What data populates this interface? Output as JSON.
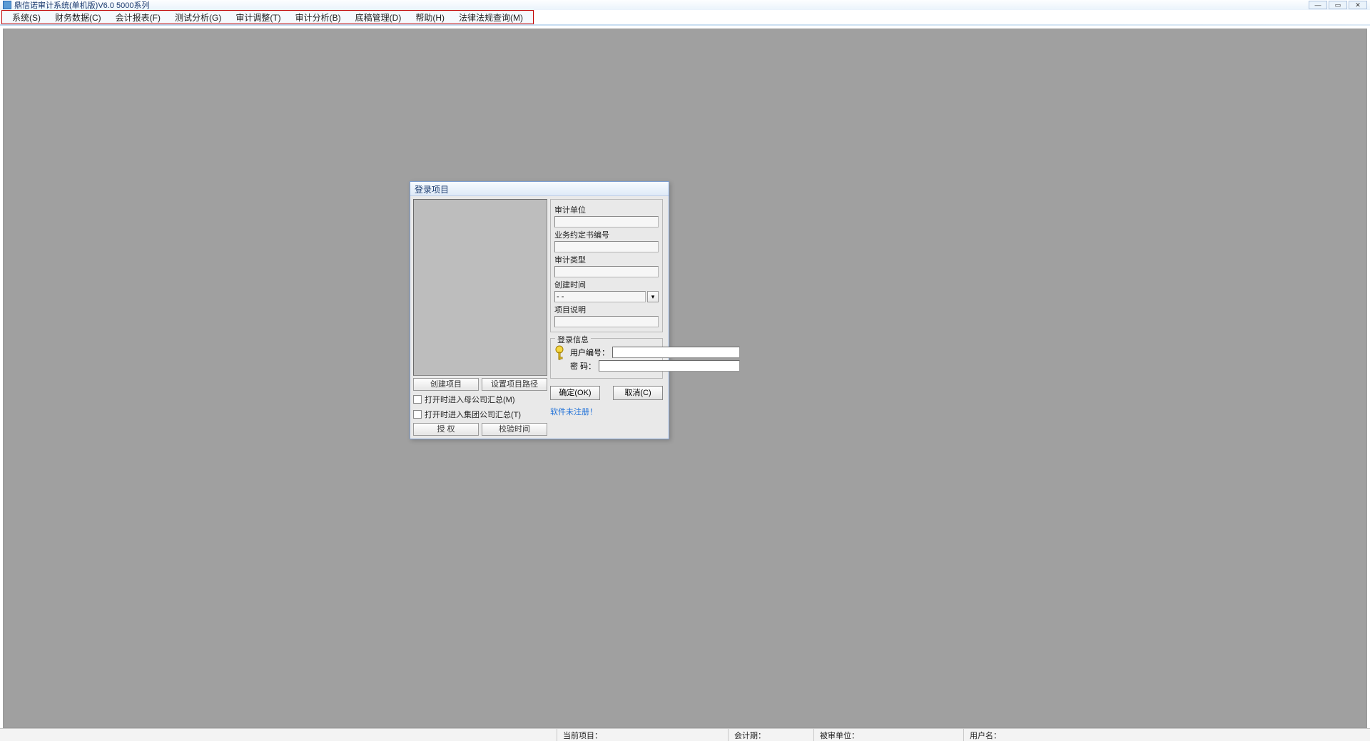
{
  "titlebar": {
    "title": "鼎信诺审计系统(单机版)V6.0 5000系列"
  },
  "menu": {
    "items": [
      "系统(S)",
      "财务数据(C)",
      "会计报表(F)",
      "测试分析(G)",
      "审计调整(T)",
      "审计分析(B)",
      "底稿管理(D)",
      "帮助(H)",
      "法律法规查询(M)"
    ]
  },
  "dialog": {
    "title": "登录项目",
    "left": {
      "create_project": "创建项目",
      "set_path": "设置项目路径",
      "cb_parent": "打开时进入母公司汇总(M)",
      "cb_group": "打开时进入集团公司汇总(T)",
      "authorize": "授    权",
      "verify_time": "校验时间"
    },
    "right": {
      "audit_unit_label": "审计单位",
      "audit_unit_value": "",
      "agreement_label": "业务约定书编号",
      "agreement_value": "",
      "audit_type_label": "审计类型",
      "audit_type_value": "",
      "create_time_label": "创建时间",
      "create_time_value": "- -",
      "desc_label": "项目说明",
      "desc_value": "",
      "login_legend": "登录信息",
      "user_label": "用户编号：",
      "user_value": "",
      "pwd_label": "密    码：",
      "pwd_value": "",
      "ok": "确定(OK)",
      "cancel": "取消(C)",
      "unregistered": "软件未注册！"
    }
  },
  "statusbar": {
    "current_project_label": "当前项目：",
    "current_project_value": "",
    "period_label": "会计期：",
    "period_value": "",
    "audited_unit_label": "被审单位：",
    "audited_unit_value": "",
    "user_label": "用户名：",
    "user_value": ""
  }
}
